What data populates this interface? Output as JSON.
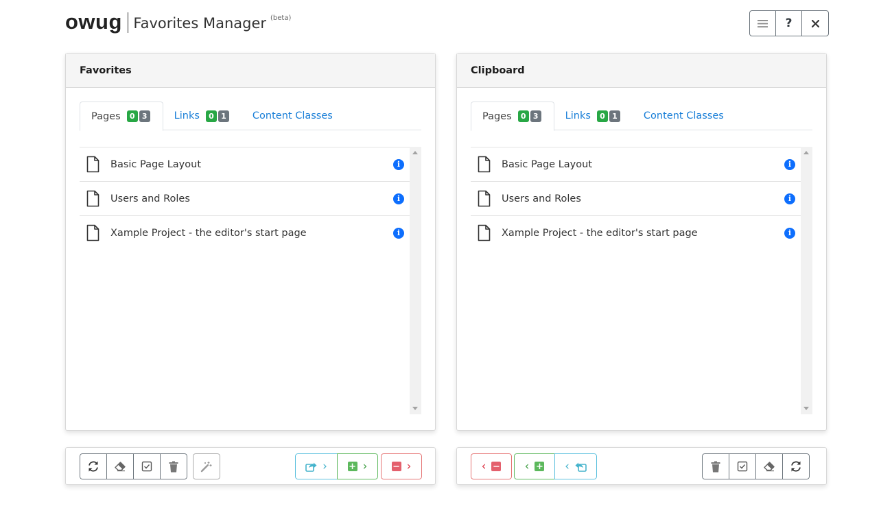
{
  "header": {
    "logo": "owug",
    "title": "Favorites Manager",
    "beta": "(beta)",
    "buttons": [
      "menu-icon",
      "help-icon",
      "close-icon"
    ]
  },
  "favorites": {
    "title": "Favorites",
    "tabs": [
      {
        "label": "Pages",
        "badge_green": "0",
        "badge_gray": "3",
        "active": true
      },
      {
        "label": "Links",
        "badge_green": "0",
        "badge_gray": "1",
        "active": false
      },
      {
        "label": "Content Classes",
        "active": false
      }
    ],
    "items": [
      {
        "label": "Basic Page Layout",
        "icon": "document-icon"
      },
      {
        "label": "Users and Roles",
        "icon": "document-icon"
      },
      {
        "label": "Xample Project - the editor's start page",
        "icon": "document-icon"
      }
    ]
  },
  "clipboard": {
    "title": "Clipboard",
    "tabs": [
      {
        "label": "Pages",
        "badge_green": "0",
        "badge_gray": "3",
        "active": true
      },
      {
        "label": "Links",
        "badge_green": "0",
        "badge_gray": "1",
        "active": false
      },
      {
        "label": "Content Classes",
        "active": false
      }
    ],
    "items": [
      {
        "label": "Basic Page Layout",
        "icon": "document-icon"
      },
      {
        "label": "Users and Roles",
        "icon": "document-icon"
      },
      {
        "label": "Xample Project - the editor's start page",
        "icon": "document-icon"
      }
    ]
  },
  "colors": {
    "link": "#1a7fd8",
    "badge_green": "#28a745",
    "badge_gray": "#6c757d",
    "info": "#0d6efd"
  },
  "toolbar_left": {
    "icons": [
      "refresh-icon",
      "eraser-icon",
      "checkbox-icon",
      "trash-icon",
      "magic-wand-icon"
    ],
    "actions": [
      "share-to-clipboard-icon",
      "add-to-clipboard-icon",
      "remove-to-clipboard-icon"
    ]
  },
  "toolbar_right": {
    "actions": [
      "remove-from-clipboard-icon",
      "add-from-clipboard-icon",
      "return-from-clipboard-icon"
    ],
    "icons": [
      "trash-icon",
      "checkbox-icon",
      "eraser-icon",
      "refresh-icon"
    ]
  }
}
